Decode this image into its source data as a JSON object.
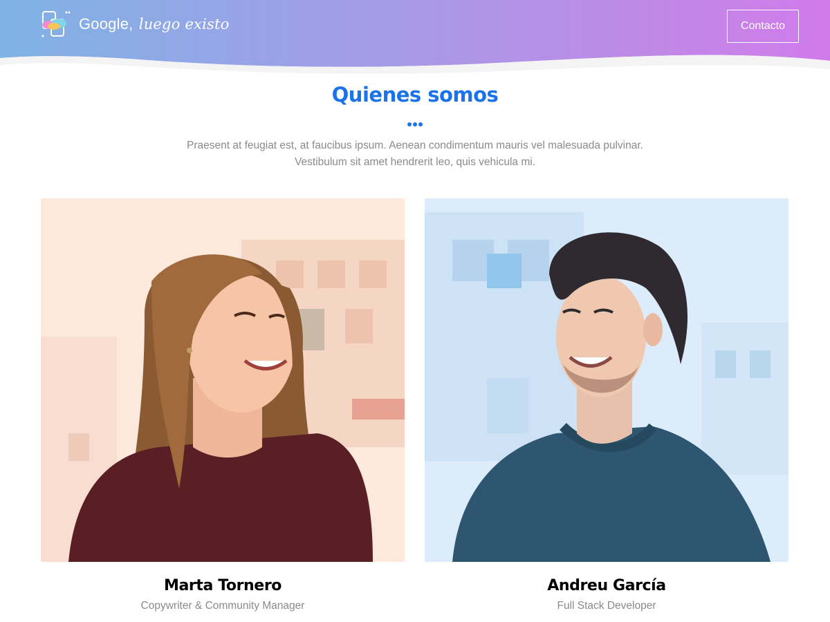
{
  "header": {
    "brand_name": "Google,",
    "brand_tagline": "luego existo",
    "contact_label": "Contacto",
    "gradient_start": "#7fb2e5",
    "gradient_end": "#d17be8"
  },
  "about": {
    "title": "Quienes somos",
    "intro_line1": "Praesent at feugiat est, at faucibus ipsum. Aenean condimentum mauris vel malesuada pulvinar.",
    "intro_line2": "Vestibulum sit amet hendrerit leo, quis vehicula mi.",
    "accent_color": "#1a73e8"
  },
  "team": [
    {
      "name": "Marta Tornero",
      "role": "Copywriter & Community Manager",
      "photo_tint": "#fde9dc"
    },
    {
      "name": "Andreu García",
      "role": "Full Stack Developer",
      "photo_tint": "#dcecfb"
    }
  ]
}
